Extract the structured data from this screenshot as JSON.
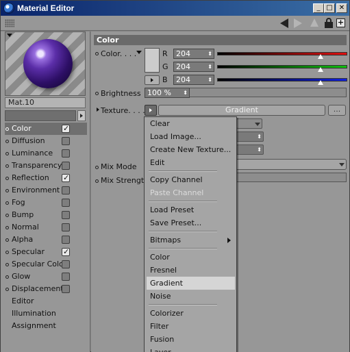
{
  "window": {
    "title": "Material Editor",
    "minimize_label": "_",
    "maximize_label": "□",
    "close_label": "✕",
    "new_window_label": "+"
  },
  "material": {
    "name": "Mat.10"
  },
  "channels": [
    {
      "label": "Color",
      "checkbox": true,
      "checked": true,
      "active": true
    },
    {
      "label": "Diffusion",
      "checkbox": true,
      "checked": false
    },
    {
      "label": "Luminance",
      "checkbox": true,
      "checked": false
    },
    {
      "label": "Transparency",
      "checkbox": true,
      "checked": false
    },
    {
      "label": "Reflection",
      "checkbox": true,
      "checked": true
    },
    {
      "label": "Environment",
      "checkbox": true,
      "checked": false
    },
    {
      "label": "Fog",
      "checkbox": true,
      "checked": false
    },
    {
      "label": "Bump",
      "checkbox": true,
      "checked": false
    },
    {
      "label": "Normal",
      "checkbox": true,
      "checked": false
    },
    {
      "label": "Alpha",
      "checkbox": true,
      "checked": false
    },
    {
      "label": "Specular",
      "checkbox": true,
      "checked": true
    },
    {
      "label": "Specular Color",
      "checkbox": true,
      "checked": false
    },
    {
      "label": "Glow",
      "checkbox": true,
      "checked": false
    },
    {
      "label": "Displacement",
      "checkbox": true,
      "checked": false
    },
    {
      "label": "Editor",
      "checkbox": false
    },
    {
      "label": "Illumination",
      "checkbox": false
    },
    {
      "label": "Assignment",
      "checkbox": false
    }
  ],
  "color_section": {
    "header": "Color",
    "color_label": "Color. . . .",
    "swatch_color": "#cccccc",
    "r_label": "R",
    "r_value": "204",
    "g_label": "G",
    "g_value": "204",
    "b_label": "B",
    "b_value": "204",
    "r_level": 0.8,
    "g_level": 0.8,
    "b_level": 0.8,
    "brightness_label": "Brightness",
    "brightness_value": "100 %",
    "texture_label": "Texture. . . .",
    "texture_value": "Gradient",
    "texture_more": "...",
    "mix_mode_label": "Mix Mode",
    "mix_strength_label": "Mix Strength"
  },
  "context_menu": {
    "groups": [
      [
        {
          "label": "Clear"
        },
        {
          "label": "Load Image..."
        },
        {
          "label": "Create New Texture..."
        },
        {
          "label": "Edit"
        }
      ],
      [
        {
          "label": "Copy Channel"
        },
        {
          "label": "Paste Channel",
          "disabled": true
        }
      ],
      [
        {
          "label": "Load Preset"
        },
        {
          "label": "Save Preset..."
        }
      ],
      [
        {
          "label": "Bitmaps",
          "submenu": true
        }
      ],
      [
        {
          "label": "Color"
        },
        {
          "label": "Fresnel"
        },
        {
          "label": "Gradient",
          "selected": true
        },
        {
          "label": "Noise"
        }
      ],
      [
        {
          "label": "Colorizer"
        },
        {
          "label": "Filter"
        },
        {
          "label": "Fusion"
        },
        {
          "label": "Layer"
        }
      ]
    ]
  },
  "colors": {
    "accent_title": "#0a246a",
    "red": "#e01010",
    "green": "#10c010",
    "blue": "#1020e0"
  }
}
